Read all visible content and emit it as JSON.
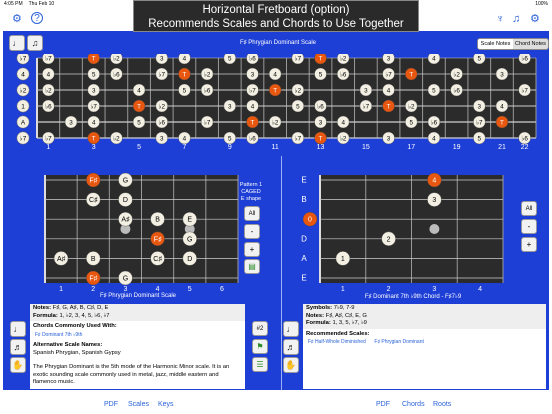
{
  "status": {
    "time": "4:05 PM",
    "date": "Thu Feb 10",
    "battery": "100%"
  },
  "banner": {
    "line1": "Horizontal Fretboard (option)",
    "line2": "Recommends Scales and Chords to Use Together"
  },
  "top_fretboard": {
    "title": "F♯ Phrygian Dominant Scale",
    "toggle": [
      "Scale Notes",
      "Chord Notes"
    ],
    "strings": [
      "♭7",
      "4",
      "♭2",
      "1",
      "A",
      "♭7"
    ],
    "fret_numbers": [
      "1",
      "3",
      "5",
      "7",
      "9",
      "11",
      "13",
      "15",
      "17",
      "19",
      "21",
      "22"
    ],
    "fret_numbers_positions": [
      1,
      3,
      5,
      7,
      9,
      11,
      13,
      15,
      17,
      19,
      21,
      22
    ],
    "dots": [
      [
        0,
        0,
        "♭7",
        "w"
      ],
      [
        0,
        2,
        "T",
        "o"
      ],
      [
        0,
        3,
        "♭2",
        "w"
      ],
      [
        0,
        5,
        "3",
        "w"
      ],
      [
        0,
        6,
        "4",
        "w"
      ],
      [
        0,
        8,
        "5",
        "w"
      ],
      [
        0,
        9,
        "♭6",
        "w"
      ],
      [
        0,
        11,
        "♭7",
        "w"
      ],
      [
        0,
        12,
        "T",
        "o"
      ],
      [
        0,
        13,
        "♭2",
        "w"
      ],
      [
        0,
        15,
        "3",
        "w"
      ],
      [
        0,
        17,
        "4",
        "w"
      ],
      [
        0,
        19,
        "5",
        "w"
      ],
      [
        0,
        21,
        "♭6",
        "w"
      ],
      [
        1,
        0,
        "4",
        "w"
      ],
      [
        1,
        2,
        "5",
        "w"
      ],
      [
        1,
        3,
        "♭6",
        "w"
      ],
      [
        1,
        5,
        "♭7",
        "w"
      ],
      [
        1,
        6,
        "T",
        "o"
      ],
      [
        1,
        7,
        "♭2",
        "w"
      ],
      [
        1,
        9,
        "3",
        "w"
      ],
      [
        1,
        10,
        "4",
        "w"
      ],
      [
        1,
        12,
        "5",
        "w"
      ],
      [
        1,
        13,
        "♭6",
        "w"
      ],
      [
        1,
        15,
        "♭7",
        "w"
      ],
      [
        1,
        16,
        "T",
        "o"
      ],
      [
        1,
        18,
        "♭2",
        "w"
      ],
      [
        1,
        20,
        "3",
        "w"
      ],
      [
        1,
        22,
        "4",
        "w"
      ],
      [
        2,
        0,
        "♭2",
        "w"
      ],
      [
        2,
        2,
        "3",
        "w"
      ],
      [
        2,
        4,
        "4",
        "w"
      ],
      [
        2,
        6,
        "5",
        "w"
      ],
      [
        2,
        7,
        "♭6",
        "w"
      ],
      [
        2,
        9,
        "♭7",
        "w"
      ],
      [
        2,
        10,
        "T",
        "o"
      ],
      [
        2,
        11,
        "♭2",
        "w"
      ],
      [
        2,
        14,
        "3",
        "w"
      ],
      [
        2,
        15,
        "4",
        "w"
      ],
      [
        2,
        17,
        "5",
        "w"
      ],
      [
        2,
        18,
        "♭6",
        "w"
      ],
      [
        2,
        21,
        "♭7",
        "w"
      ],
      [
        3,
        0,
        "♭6",
        "w"
      ],
      [
        3,
        2,
        "♭7",
        "w"
      ],
      [
        3,
        4,
        "T",
        "o"
      ],
      [
        3,
        5,
        "♭2",
        "w"
      ],
      [
        3,
        8,
        "3",
        "w"
      ],
      [
        3,
        9,
        "4",
        "w"
      ],
      [
        3,
        11,
        "5",
        "w"
      ],
      [
        3,
        12,
        "♭6",
        "w"
      ],
      [
        3,
        14,
        "♭7",
        "w"
      ],
      [
        3,
        15,
        "T",
        "o"
      ],
      [
        3,
        16,
        "♭2",
        "w"
      ],
      [
        3,
        19,
        "3",
        "w"
      ],
      [
        3,
        20,
        "4",
        "w"
      ],
      [
        4,
        1,
        "3",
        "w"
      ],
      [
        4,
        2,
        "4",
        "w"
      ],
      [
        4,
        4,
        "5",
        "w"
      ],
      [
        4,
        5,
        "♭6",
        "w"
      ],
      [
        4,
        7,
        "♭7",
        "w"
      ],
      [
        4,
        9,
        "T",
        "o"
      ],
      [
        4,
        10,
        "♭2",
        "w"
      ],
      [
        4,
        12,
        "3",
        "w"
      ],
      [
        4,
        13,
        "4",
        "w"
      ],
      [
        4,
        16,
        "5",
        "w"
      ],
      [
        4,
        17,
        "♭6",
        "w"
      ],
      [
        4,
        19,
        "♭7",
        "w"
      ],
      [
        4,
        20,
        "T",
        "o"
      ],
      [
        4,
        22,
        "♭2",
        "w"
      ],
      [
        5,
        0,
        "♭7",
        "w"
      ],
      [
        5,
        2,
        "T",
        "o"
      ],
      [
        5,
        3,
        "♭2",
        "w"
      ],
      [
        5,
        5,
        "3",
        "w"
      ],
      [
        5,
        6,
        "4",
        "w"
      ],
      [
        5,
        8,
        "5",
        "w"
      ],
      [
        5,
        9,
        "♭6",
        "w"
      ],
      [
        5,
        11,
        "♭7",
        "w"
      ],
      [
        5,
        12,
        "T",
        "o"
      ],
      [
        5,
        13,
        "♭2",
        "w"
      ],
      [
        5,
        15,
        "3",
        "w"
      ],
      [
        5,
        17,
        "4",
        "w"
      ],
      [
        5,
        19,
        "5",
        "w"
      ],
      [
        5,
        21,
        "♭6",
        "w"
      ],
      [
        5,
        22,
        "♭7",
        "w"
      ]
    ]
  },
  "left_panel": {
    "caption": "F♯ Phrygian Dominant Scale",
    "pattern": [
      "Pattern 1",
      "CAGED",
      "E shape"
    ],
    "all_label": "All",
    "minus_label": "-",
    "plus_label": "+",
    "fret_numbers": [
      "1",
      "2",
      "3",
      "4",
      "5",
      "6"
    ],
    "dots": [
      [
        0,
        1,
        "F♯",
        "o"
      ],
      [
        0,
        2,
        "G",
        "w"
      ],
      [
        1,
        1,
        "C♯",
        "w"
      ],
      [
        1,
        2,
        "D",
        "w"
      ],
      [
        2,
        2,
        "A♯",
        "w"
      ],
      [
        2,
        3,
        "B",
        "w"
      ],
      [
        2,
        4,
        "E",
        "w"
      ],
      [
        3,
        3,
        "F♯",
        "o"
      ],
      [
        3,
        4,
        "G",
        "w"
      ],
      [
        4,
        0,
        "A♯",
        "w"
      ],
      [
        4,
        1,
        "B",
        "w"
      ],
      [
        4,
        3,
        "C♯",
        "w"
      ],
      [
        4,
        4,
        "D",
        "w"
      ],
      [
        5,
        1,
        "F♯",
        "o"
      ],
      [
        5,
        2,
        "G",
        "w"
      ]
    ],
    "notes_label": "Notes:",
    "notes_value": "F♯, G, A♯, B, C♯, D, E",
    "formula_label": "Formula:",
    "formula_value": "1, ♭2, 3, 4, 5, ♭6, ♭7",
    "chords_heading": "Chords Commonly Used With:",
    "chords": [
      "F♯ Dominant 7th ♭9th"
    ],
    "alt_heading": "Alternative Scale Names:",
    "alt_value": "Spanish Phrygian, Spanish Gypsy",
    "description": "The Phrygian Dominant is the 5th mode of the Harmonic Minor scale. It is an exotic sounding scale commonly used in metal, jazz, middle eastern and flamenco music.",
    "sharp_label": "#2"
  },
  "right_panel": {
    "caption": "F♯ Dominant 7th ♭9th Chord - F♯7♭9",
    "strings": [
      "E",
      "B",
      "G",
      "D",
      "A",
      "E"
    ],
    "all_label": "All",
    "minus_label": "-",
    "plus_label": "+",
    "fret_numbers": [
      "1",
      "2",
      "3",
      "4"
    ],
    "dots": [
      [
        0,
        2,
        "4",
        "o"
      ],
      [
        1,
        2,
        "3",
        "w"
      ],
      [
        2,
        -1,
        "0",
        "o"
      ],
      [
        3,
        1,
        "2",
        "w"
      ],
      [
        4,
        0,
        "1",
        "w"
      ]
    ],
    "symbols_label": "Symbols:",
    "symbols_value": "7♭9, 7-9",
    "notes_label": "Notes:",
    "notes_value": "F♯, A♯, C♯, E, G",
    "formula_label": "Formula:",
    "formula_value": "1, 3, 5, ♭7, ♭9",
    "rec_heading": "Recommended Scales:",
    "scales": [
      "F♯ Half-Whole Diminished",
      "F♯ Phrygian Dominant"
    ]
  },
  "bottom_tabs": {
    "left": [
      "PDF",
      "Scales",
      "Keys"
    ],
    "right": [
      "PDF",
      "Chords",
      "Roots"
    ]
  },
  "colors": {
    "blue": "#1e3fd6",
    "orange": "#e8570f",
    "dot_white": "#f3f0e3",
    "link": "#2a62d8"
  }
}
